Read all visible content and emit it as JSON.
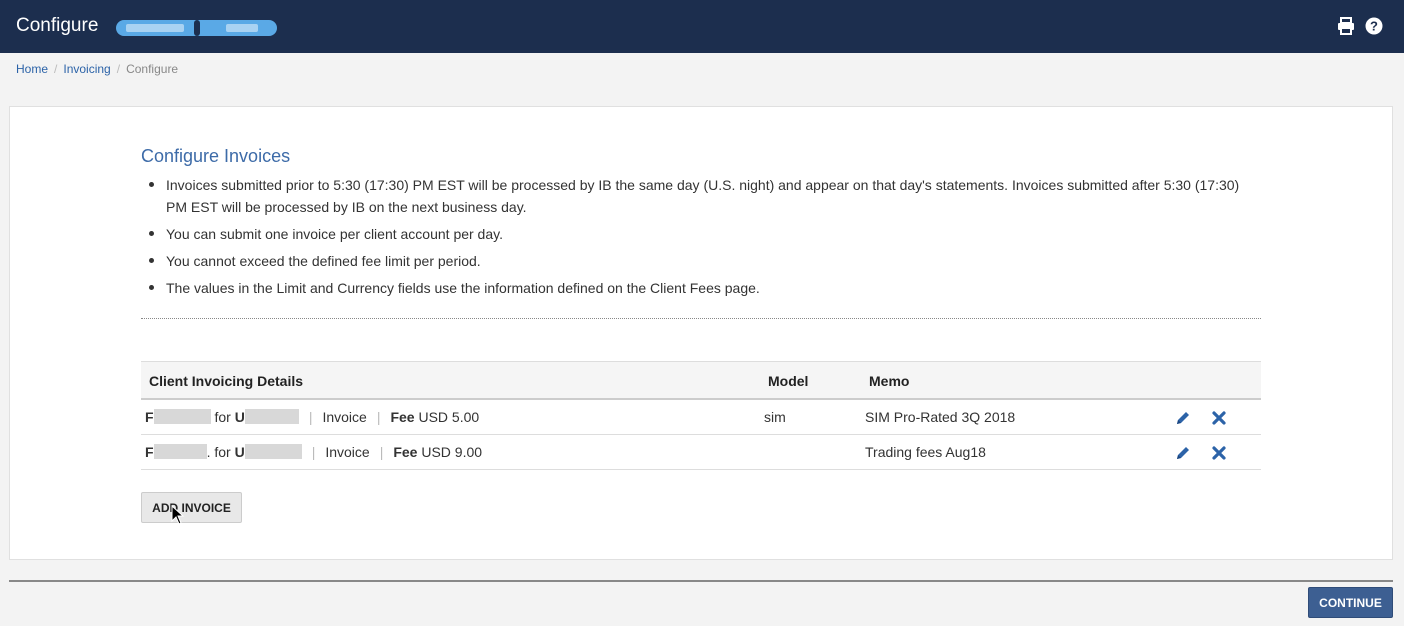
{
  "header": {
    "title": "Configure",
    "print_icon": "print-icon",
    "help_icon": "question-circle-icon",
    "bg_color": "#1c2e4e"
  },
  "breadcrumb": {
    "items": [
      "Home",
      "Invoicing"
    ],
    "current": "Configure"
  },
  "section": {
    "title": "Configure Invoices",
    "notes": [
      "Invoices submitted prior to 5:30 (17:30) PM EST will be processed by IB the same day (U.S. night) and appear on that day's statements. Invoices submitted after 5:30 (17:30) PM EST will be processed by IB on the next business day.",
      "You can submit one invoice per client account per day.",
      "You cannot exceed the defined fee limit per period.",
      "The values in the Limit and Currency fields use the information defined on the Client Fees page."
    ]
  },
  "table": {
    "headers": {
      "details": "Client Invoicing Details",
      "model": "Model",
      "memo": "Memo"
    },
    "rows": [
      {
        "from_prefix": "F",
        "for_text": "for",
        "to_prefix": "U",
        "type": "Invoice",
        "fee_label": "Fee",
        "fee_value": "USD 5.00",
        "model": "sim",
        "memo": "SIM Pro-Rated 3Q 2018"
      },
      {
        "from_prefix": "F",
        "for_text": ". for",
        "to_prefix": "U",
        "type": "Invoice",
        "fee_label": "Fee",
        "fee_value": "USD 9.00",
        "model": "",
        "memo": "Trading fees Aug18"
      }
    ],
    "edit_icon": "pencil-icon",
    "delete_icon": "close-x-icon"
  },
  "buttons": {
    "add_invoice": "ADD INVOICE",
    "continue": "CONTINUE"
  },
  "colors": {
    "link": "#2c63a8",
    "title": "#3d6ba8",
    "continue_bg": "#3d5f92"
  }
}
